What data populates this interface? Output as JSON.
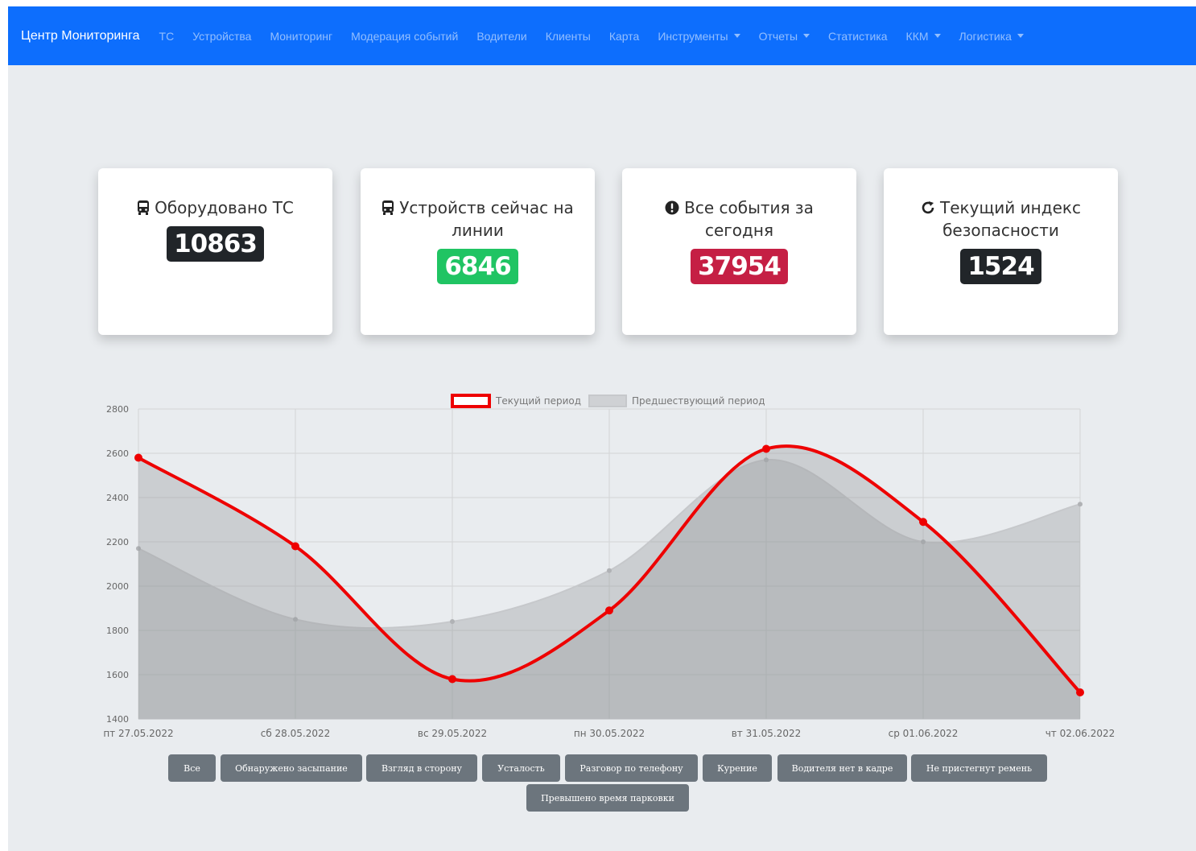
{
  "navbar": {
    "brand": "Центр Мониторинга",
    "items": [
      {
        "label": "ТС"
      },
      {
        "label": "Устройства"
      },
      {
        "label": "Мониторинг"
      },
      {
        "label": "Модерация событий"
      },
      {
        "label": "Водители"
      },
      {
        "label": "Клиенты"
      },
      {
        "label": "Карта"
      },
      {
        "label": "Инструменты",
        "dropdown": true
      },
      {
        "label": "Отчеты",
        "dropdown": true
      },
      {
        "label": "Статистика"
      },
      {
        "label": "ККМ",
        "dropdown": true
      },
      {
        "label": "Логистика",
        "dropdown": true
      }
    ]
  },
  "cards": [
    {
      "icon": "bus-icon",
      "title": "Оборудовано ТС",
      "value": "10863",
      "color": "#212529"
    },
    {
      "icon": "bus-icon",
      "title": "Устройств сейчас на линии",
      "value": "6846",
      "color": "#198754"
    },
    {
      "icon": "exclamation-circle-icon",
      "title": "Все события за сегодня",
      "value": "37954",
      "color": "#c51f44"
    },
    {
      "icon": "refresh-icon",
      "title": "Текущий индекс безопасности",
      "value": "1524",
      "color": "#212529"
    }
  ],
  "chart_data": {
    "type": "line",
    "categories": [
      "пт 27.05.2022",
      "сб 28.05.2022",
      "вс 29.05.2022",
      "пн 30.05.2022",
      "вт 31.05.2022",
      "ср 01.06.2022",
      "чт 02.06.2022"
    ],
    "series": [
      {
        "name": "Текущий период",
        "values": [
          2580,
          2180,
          1580,
          1890,
          2620,
          2290,
          1520
        ],
        "color": "#ee0000"
      },
      {
        "name": "Предшествующий период",
        "values": [
          2170,
          1850,
          1840,
          2070,
          2570,
          2200,
          2370
        ],
        "color": "#c9cbce",
        "fill": true
      }
    ],
    "ylim": [
      1400,
      2800
    ],
    "yticks": [
      "2800",
      "2600",
      "2400",
      "2200",
      "2000",
      "1800",
      "1600",
      "1400"
    ],
    "grid": true,
    "legend": "top-center"
  },
  "filters": [
    "Все",
    "Обнаружено засыпание",
    "Взгляд в сторону",
    "Усталость",
    "Разговор по телефону",
    "Курение",
    "Водителя нет в кадре",
    "Не пристегнут ремень",
    "Превышено время парковки"
  ]
}
